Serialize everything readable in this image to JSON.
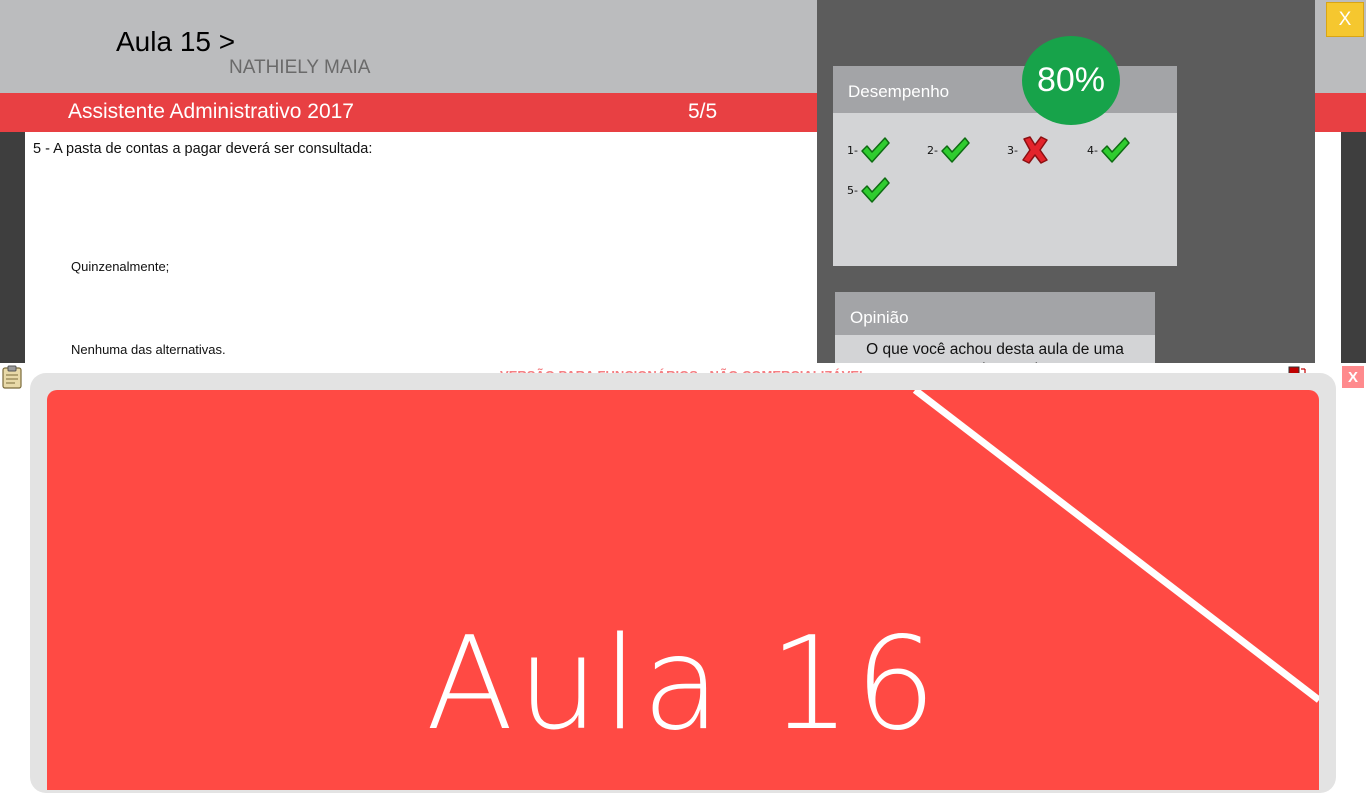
{
  "header": {
    "lesson_title": "Aula 15 >",
    "student_name": "NATHIELY MAIA"
  },
  "course_bar": {
    "course_title": "Assistente Administrativo 2017",
    "progress": "5/5"
  },
  "question": {
    "text": "5 - A pasta de contas a pagar deverá ser consultada:",
    "answers": [
      "Quinzenalmente;",
      "Nenhuma das alternativas."
    ]
  },
  "performance": {
    "title": "Desempenho",
    "score": "80%",
    "results": [
      {
        "label": "1-",
        "status": "correct"
      },
      {
        "label": "2-",
        "status": "correct"
      },
      {
        "label": "3-",
        "status": "wrong"
      },
      {
        "label": "4-",
        "status": "correct"
      },
      {
        "label": "5-",
        "status": "correct"
      }
    ]
  },
  "opinion": {
    "title": "Opinião",
    "question": "O que você achou desta aula de uma maneira geral?"
  },
  "close_label": "X",
  "popup": {
    "watermark": "VERSÃO PARA FUNCIONÁRIOS - NÃO COMERCIALIZÁVEL",
    "close_label": "X",
    "slide_title": "Aula 16"
  },
  "icons": {
    "clipboard": "clipboard-icon",
    "monitor": "monitor-notes-icon",
    "correct": "green-check-icon",
    "wrong": "red-x-icon"
  },
  "colors": {
    "header_gray": "#bbbcbe",
    "red_bar": "#e84043",
    "panel_dark": "#5c5c5c",
    "score_green": "#17a34a",
    "slide_red": "#ff4a44",
    "close_yellow": "#f5c72f"
  }
}
